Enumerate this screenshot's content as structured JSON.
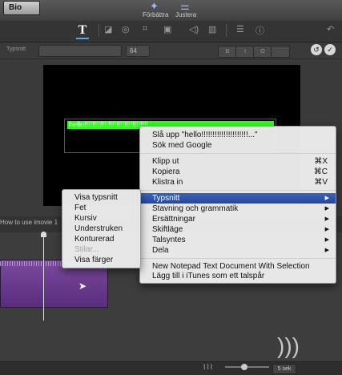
{
  "topbar": {
    "tab_label": "Bio",
    "enhance_label": "Förbättra",
    "adjust_label": "Justera"
  },
  "fontbar": {
    "font_label": "Typsnitt",
    "font_size": "64",
    "bold": "B",
    "italic": "I",
    "outline": "O"
  },
  "viewer": {
    "title_text": "hello!!!!!!!!!!!!!!!!!!!!!!!!!!!!!!!!"
  },
  "timeline": {
    "project_title": "How to use imovie 1",
    "zoom_value": "5 sek"
  },
  "context_menu": {
    "lookup": "Slå upp \"hello!!!!!!!!!!!!!!!!!!!!!...\"",
    "search_google": "Sök med Google",
    "cut": "Klipp ut",
    "cut_shortcut": "⌘X",
    "copy": "Kopiera",
    "copy_shortcut": "⌘C",
    "paste": "Klistra in",
    "paste_shortcut": "⌘V",
    "font": "Typsnitt",
    "spelling": "Stavning och grammatik",
    "substitutions": "Ersättningar",
    "transformations": "Skiftläge",
    "speech": "Talsyntes",
    "share": "Dela",
    "service_1": "New Notepad Text Document With Selection",
    "service_2": "Lägg till i iTunes som ett talspår"
  },
  "font_submenu": {
    "show_fonts": "Visa typsnitt",
    "bold": "Fet",
    "italic": "Kursiv",
    "underline": "Understruken",
    "outline": "Konturerad",
    "styles": "Stilar...",
    "show_colors": "Visa färger"
  },
  "colors": {
    "highlight": "#2dff1a",
    "menu_selected": "#2c4fa8",
    "clip": "#6a3a8e"
  }
}
